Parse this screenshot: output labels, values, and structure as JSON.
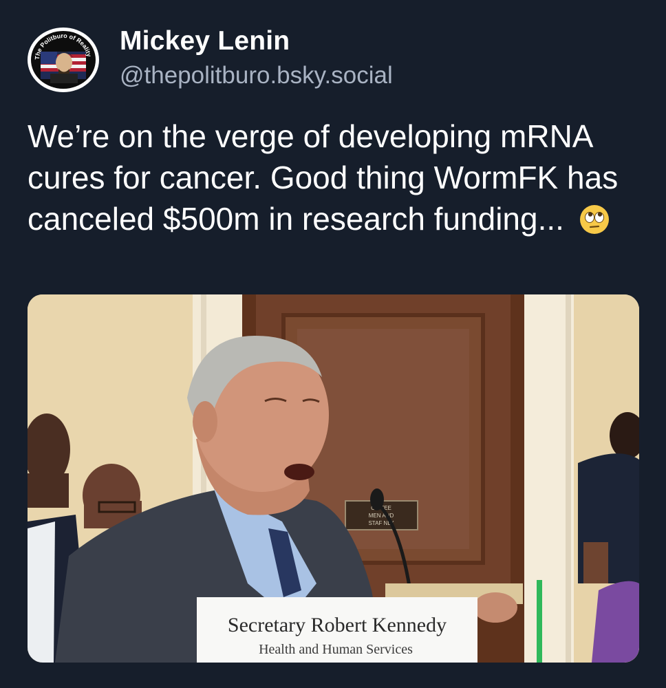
{
  "author": {
    "display_name": "Mickey Lenin",
    "handle": "@thepolitburo.bsky.social",
    "avatar_ring_text": "The Politburo of Reality Mockery",
    "avatar_icon": "avatar-politburo-portrait"
  },
  "post": {
    "text": "We’re on the verge of developing mRNA cures for cancer. Good thing WormFK has canceled $500m in research funding...",
    "emoji": "eye-roll-emoji"
  },
  "media": {
    "placard_title": "Secretary Robert Kennedy",
    "placard_subtitle": "Health and Human Services",
    "door_sign_line1": "CO      TEE",
    "door_sign_line2": "MEN       AND",
    "door_sign_line3": "STAF     NLY"
  },
  "colors": {
    "background": "#161e2b",
    "text_primary": "#ffffff",
    "text_secondary": "#a9b3c3"
  }
}
